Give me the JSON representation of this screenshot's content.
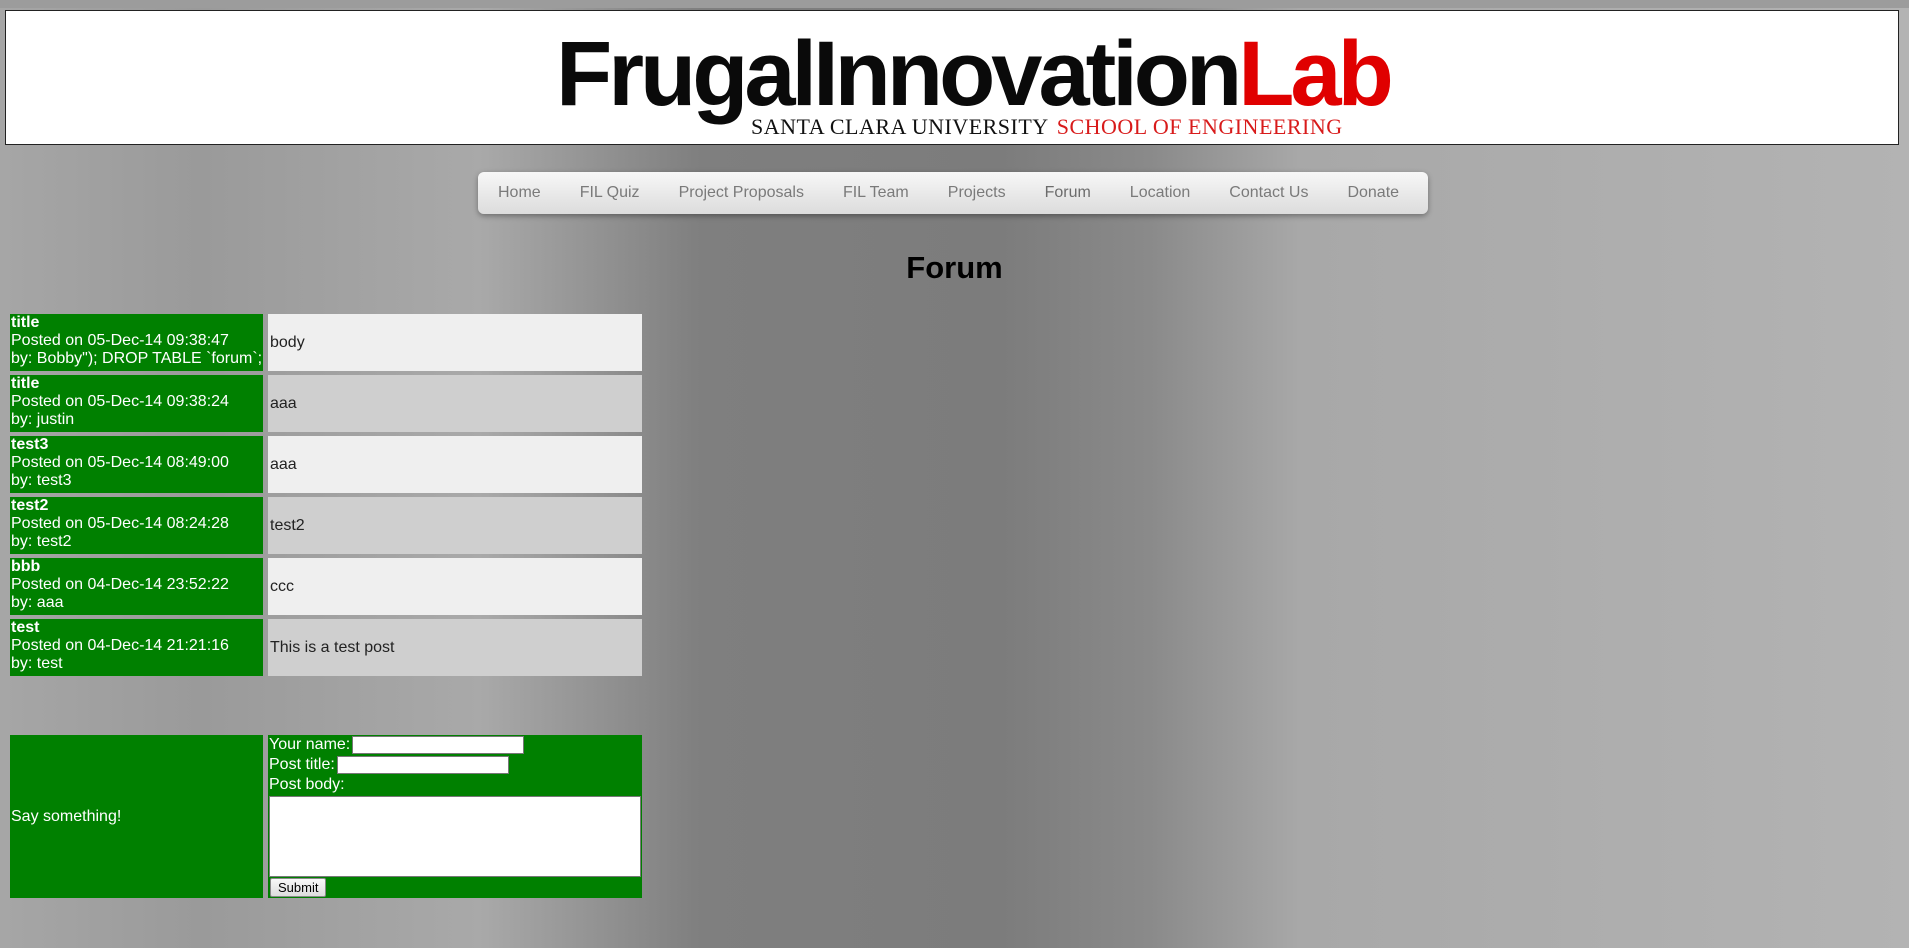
{
  "logo": {
    "main_black": "FrugalInnovation",
    "main_red": "Lab",
    "sub_black": "SANTA CLARA UNIVERSITY",
    "sub_red": "SCHOOL OF ENGINEERING"
  },
  "nav": {
    "items": [
      "Home",
      "FIL Quiz",
      "Project Proposals",
      "FIL Team",
      "Projects",
      "Forum",
      "Location",
      "Contact Us",
      "Donate"
    ],
    "active": "Forum"
  },
  "page": {
    "title": "Forum"
  },
  "posts": [
    {
      "title": "title",
      "posted": "Posted on 05-Dec-14 09:38:47",
      "by": "by: Bobby\"); DROP TABLE `forum`;",
      "body": "body"
    },
    {
      "title": "title",
      "posted": "Posted on 05-Dec-14 09:38:24",
      "by": "by: justin",
      "body": "aaa"
    },
    {
      "title": "test3",
      "posted": "Posted on 05-Dec-14 08:49:00",
      "by": "by: test3",
      "body": "aaa"
    },
    {
      "title": "test2",
      "posted": "Posted on 05-Dec-14 08:24:28",
      "by": "by: test2",
      "body": "test2"
    },
    {
      "title": "bbb",
      "posted": "Posted on 04-Dec-14 23:52:22",
      "by": "by: aaa",
      "body": "ccc"
    },
    {
      "title": "test",
      "posted": "Posted on 04-Dec-14 21:21:16",
      "by": "by: test",
      "body": "This is a test post"
    }
  ],
  "compose": {
    "label": "Say something!",
    "name_label": "Your name:",
    "name_value": "",
    "title_label": "Post title:",
    "title_value": "",
    "body_label": "Post body:",
    "body_value": "",
    "submit_label": "Submit"
  },
  "colors": {
    "post_meta_bg": "#008000",
    "logo_red": "#e00000",
    "nav_text": "#7a7a7a"
  }
}
